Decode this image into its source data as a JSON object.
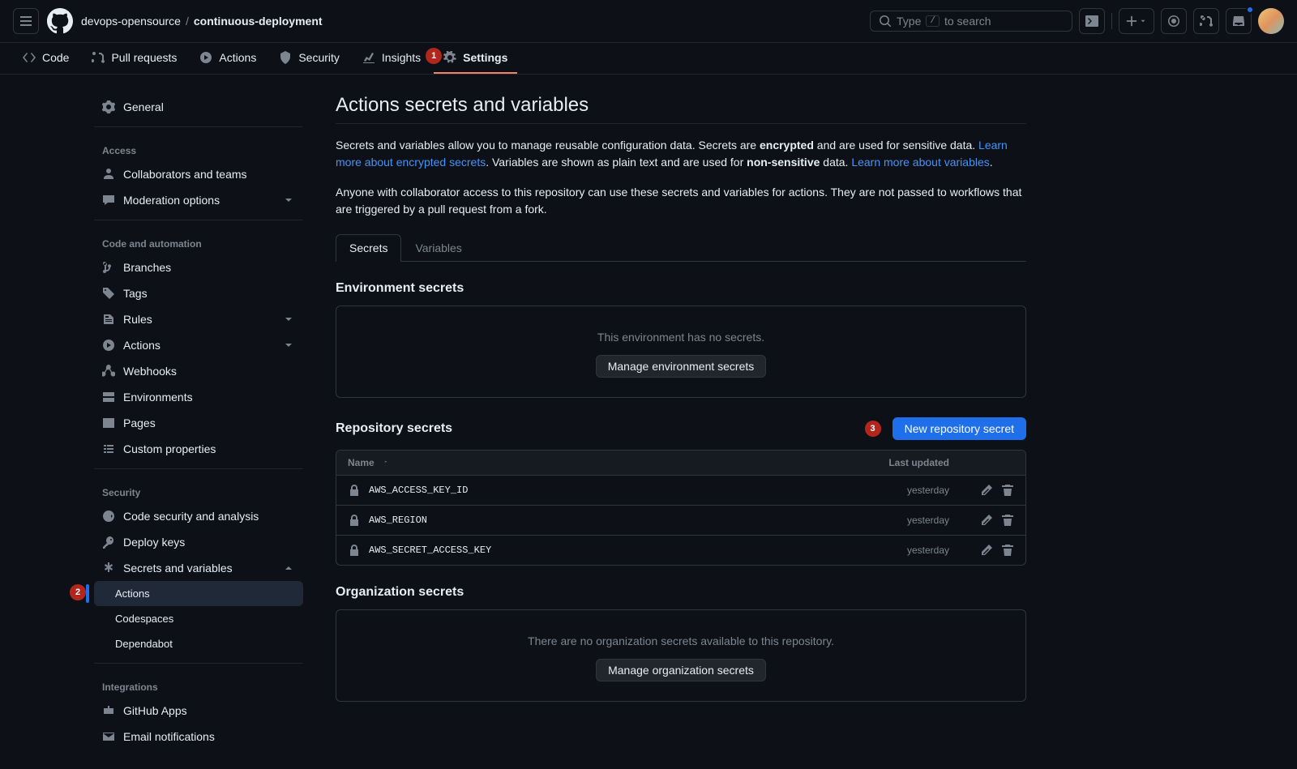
{
  "breadcrumb": {
    "owner": "devops-opensource",
    "repo": "continuous-deployment"
  },
  "search": {
    "hint_pre": "Type",
    "hint_key": "/",
    "hint_post": "to search"
  },
  "repoTabs": {
    "code": "Code",
    "pulls": "Pull requests",
    "actions": "Actions",
    "security": "Security",
    "insights": "Insights",
    "settings": "Settings"
  },
  "annotations": {
    "one": "1",
    "two": "2",
    "three": "3"
  },
  "sidebar": {
    "general": "General",
    "groups": {
      "access": "Access",
      "code": "Code and automation",
      "security": "Security",
      "integrations": "Integrations"
    },
    "access": {
      "collab": "Collaborators and teams",
      "moderation": "Moderation options"
    },
    "code": {
      "branches": "Branches",
      "tags": "Tags",
      "rules": "Rules",
      "actions": "Actions",
      "webhooks": "Webhooks",
      "environments": "Environments",
      "pages": "Pages",
      "custom": "Custom properties"
    },
    "security": {
      "codeSec": "Code security and analysis",
      "deploy": "Deploy keys",
      "secrets": "Secrets and variables",
      "sub": {
        "actions": "Actions",
        "codespaces": "Codespaces",
        "dependabot": "Dependabot"
      }
    },
    "integrations": {
      "apps": "GitHub Apps",
      "email": "Email notifications"
    }
  },
  "page": {
    "title": "Actions secrets and variables",
    "intro1a": "Secrets and variables allow you to manage reusable configuration data. Secrets are ",
    "intro1b": "encrypted",
    "intro1c": " and are used for sensitive data. ",
    "link1": "Learn more about encrypted secrets",
    "intro1d": ". Variables are shown as plain text and are used for ",
    "intro1e": "non-sensitive",
    "intro1f": " data. ",
    "link2": "Learn more about variables",
    "intro1g": ".",
    "intro2": "Anyone with collaborator access to this repository can use these secrets and variables for actions. They are not passed to workflows that are triggered by a pull request from a fork.",
    "tabs": {
      "secrets": "Secrets",
      "variables": "Variables"
    },
    "env": {
      "heading": "Environment secrets",
      "empty": "This environment has no secrets.",
      "button": "Manage environment secrets"
    },
    "repo": {
      "heading": "Repository secrets",
      "button": "New repository secret",
      "colName": "Name",
      "colUpdated": "Last updated",
      "rows": [
        {
          "name": "AWS_ACCESS_KEY_ID",
          "updated": "yesterday"
        },
        {
          "name": "AWS_REGION",
          "updated": "yesterday"
        },
        {
          "name": "AWS_SECRET_ACCESS_KEY",
          "updated": "yesterday"
        }
      ]
    },
    "org": {
      "heading": "Organization secrets",
      "empty": "There are no organization secrets available to this repository.",
      "button": "Manage organization secrets"
    }
  }
}
